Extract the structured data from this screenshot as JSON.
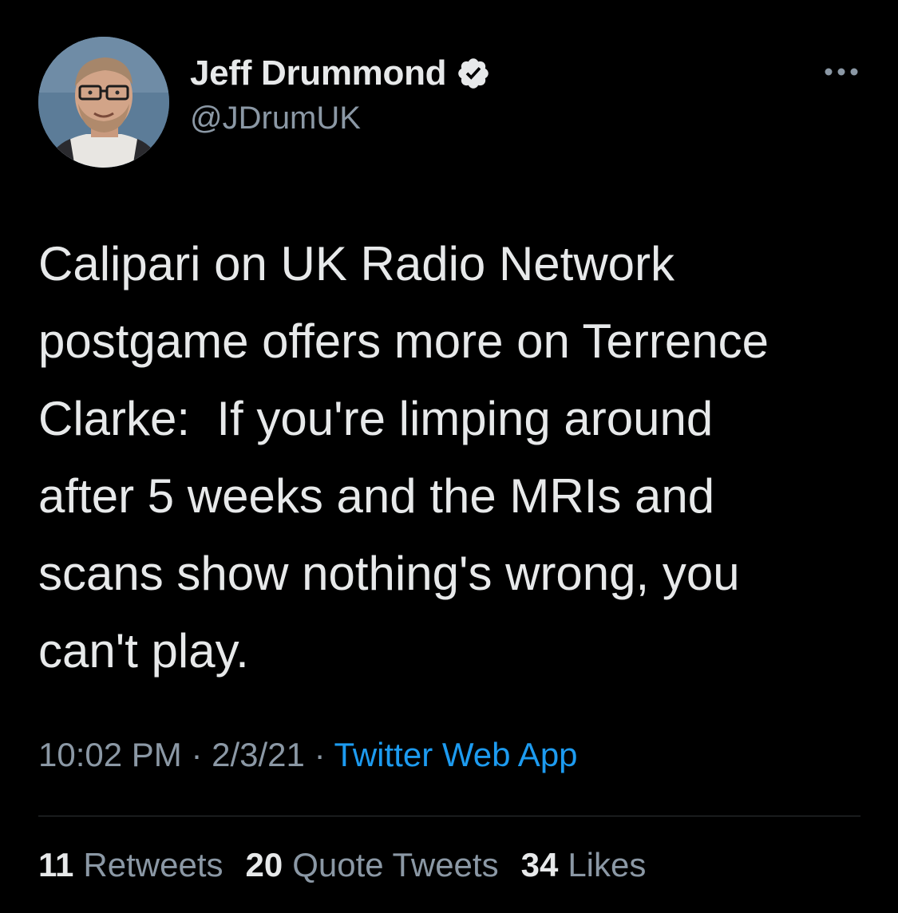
{
  "author": {
    "display_name": "Jeff Drummond",
    "handle": "@JDrumUK",
    "verified": true,
    "avatar_icon": "profile-photo"
  },
  "menu": {
    "icon": "more-options-icon"
  },
  "tweet": {
    "text": "Calipari on UK Radio Network\npostgame offers more on Terrence\nClarke:  If you're limping around\nafter 5 weeks and the MRIs and\nscans show nothing's wrong, you\ncan't play."
  },
  "meta": {
    "time": "10:02 PM",
    "separator": "·",
    "date": "2/3/21",
    "source": "Twitter Web App"
  },
  "stats": {
    "retweets_count": "11",
    "retweets_label": "Retweets",
    "quotes_count": "20",
    "quotes_label": "Quote Tweets",
    "likes_count": "34",
    "likes_label": "Likes"
  },
  "colors": {
    "background": "#000000",
    "text_primary": "#e7e9ea",
    "text_secondary": "#8b98a5",
    "link": "#1d9bf0",
    "divider": "#2f3336"
  }
}
